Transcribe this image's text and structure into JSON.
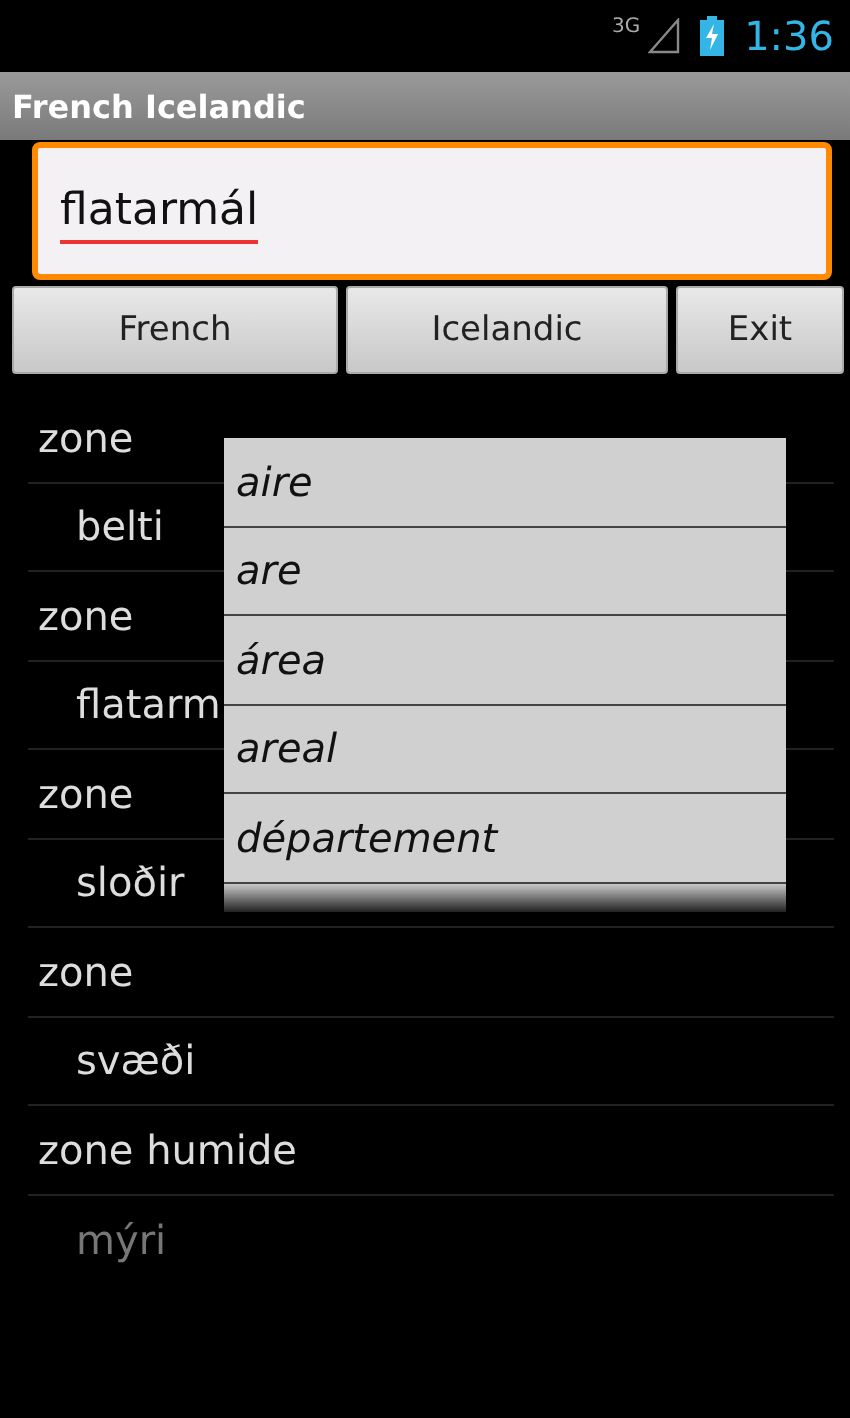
{
  "status_bar": {
    "network": "3G",
    "time": "1:36"
  },
  "title_bar": {
    "title": "French Icelandic"
  },
  "search": {
    "value": "flatarmál",
    "spell_error": true
  },
  "buttons": [
    "French",
    "Icelandic",
    "Exit"
  ],
  "entries": [
    {
      "term": "zone",
      "translation": "belti"
    },
    {
      "term": "zone",
      "translation": "flatarm"
    },
    {
      "term": "zone",
      "translation": "sloðir"
    },
    {
      "term": "zone",
      "translation": "svæði"
    },
    {
      "term": "zone humide",
      "translation": "mýri"
    }
  ],
  "suggestions": [
    "aire",
    "are",
    "área",
    "areal",
    "département"
  ]
}
